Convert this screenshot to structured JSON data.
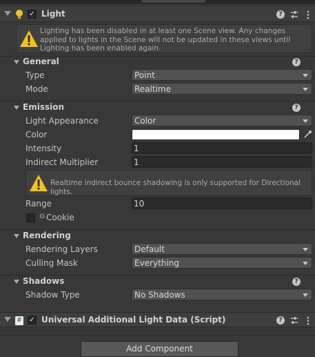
{
  "light_component": {
    "title": "Light",
    "warning": "Lighting has been disabled in at least one Scene view. Any changes applied to lights in the Scene will not be updated in these views until Lighting has been enabled again.",
    "icons": {
      "component": "lightbulb-icon",
      "help": "help-icon",
      "presets": "sliders-icon",
      "menu": "kebab-menu-icon"
    }
  },
  "general": {
    "title": "General",
    "type_label": "Type",
    "type_value": "Point",
    "mode_label": "Mode",
    "mode_value": "Realtime"
  },
  "emission": {
    "title": "Emission",
    "light_appearance_label": "Light Appearance",
    "light_appearance_value": "Color",
    "color_label": "Color",
    "color_value": "#ffffff",
    "intensity_label": "Intensity",
    "intensity_value": "1",
    "indirect_multiplier_label": "Indirect Multiplier",
    "indirect_multiplier_value": "1",
    "indirect_warning": "Realtime indirect bounce shadowing is only supported for Directional lights.",
    "range_label": "Range",
    "range_value": "10",
    "cookie_label": "Cookie"
  },
  "rendering": {
    "title": "Rendering",
    "rendering_layers_label": "Rendering Layers",
    "rendering_layers_value": "Default",
    "culling_mask_label": "Culling Mask",
    "culling_mask_value": "Everything"
  },
  "shadows": {
    "title": "Shadows",
    "shadow_type_label": "Shadow Type",
    "shadow_type_value": "No Shadows"
  },
  "additional_data_component": {
    "title": "Universal Additional Light Data (Script)"
  },
  "add_component_label": "Add Component",
  "colors": {
    "warning_yellow": "#f4c21a",
    "background": "#383838",
    "accent_text": "#c4c4c4"
  }
}
